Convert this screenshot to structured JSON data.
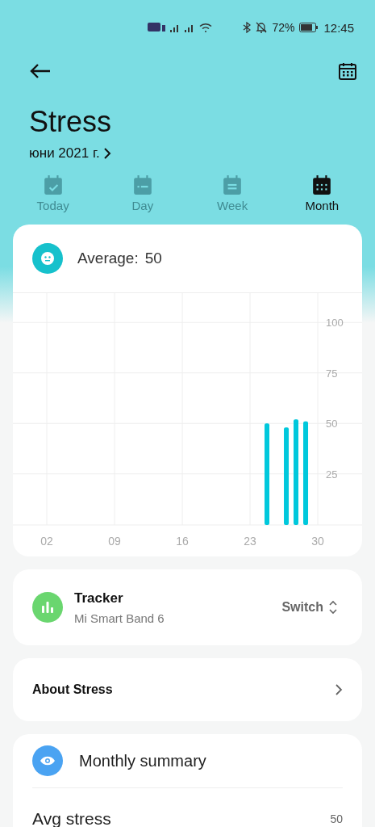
{
  "status_bar": {
    "battery": "72%",
    "time": "12:45"
  },
  "header": {
    "title": "Stress",
    "period": "юни 2021 г."
  },
  "tabs": [
    {
      "label": "Today",
      "selected": false,
      "kind": "today"
    },
    {
      "label": "Day",
      "selected": false,
      "kind": "day"
    },
    {
      "label": "Week",
      "selected": false,
      "kind": "week"
    },
    {
      "label": "Month",
      "selected": true,
      "kind": "month"
    }
  ],
  "average": {
    "label": "Average:",
    "value": "50"
  },
  "chart_data": {
    "type": "bar",
    "x": [
      24.75,
      26.75,
      27.75,
      28.75
    ],
    "xlim": [
      -1.5,
      34.58
    ],
    "grid": true,
    "series": [
      {
        "color": "#00c8dc",
        "values": [
          50,
          48,
          52,
          51
        ]
      }
    ],
    "xticks": [
      {
        "value": 2,
        "label": "02"
      },
      {
        "value": 9,
        "label": "09"
      },
      {
        "value": 16,
        "label": "16"
      },
      {
        "value": 23,
        "label": "23"
      },
      {
        "value": 30,
        "label": "30"
      }
    ],
    "yticks": [
      25,
      50,
      75,
      100
    ],
    "ylim": [
      -15.9,
      148.5
    ]
  },
  "tracker": {
    "title": "Tracker",
    "device": "Mi Smart Band 6",
    "action": "Switch"
  },
  "about": {
    "label": "About Stress"
  },
  "summary": {
    "title": "Monthly summary",
    "rows": [
      {
        "label": "Avg stress",
        "value": "50"
      }
    ]
  }
}
